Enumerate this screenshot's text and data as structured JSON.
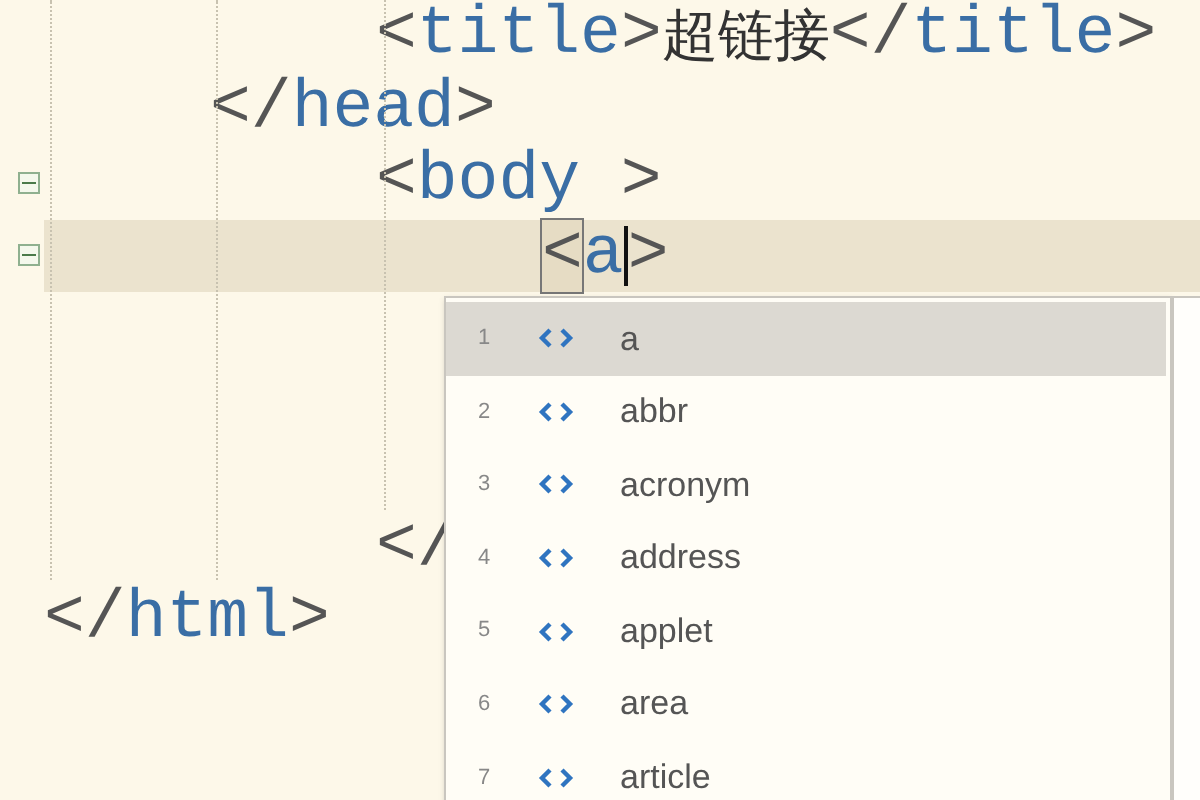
{
  "editor": {
    "children": [
      {
        "children": [
          {
            "children": [
              {
                "current": false,
                "tokens": [
                  {
                    "kind": "punct",
                    "text": "<"
                  },
                  {
                    "kind": "tag",
                    "text": "title"
                  },
                  {
                    "kind": "punct",
                    "text": ">"
                  },
                  {
                    "kind": "text",
                    "text": "超链接"
                  },
                  {
                    "kind": "punct",
                    "text": "</"
                  },
                  {
                    "kind": "tag",
                    "text": "title"
                  },
                  {
                    "kind": "punct",
                    "text": ">"
                  }
                ]
              }
            ]
          },
          {
            "current": false,
            "tokens": [
              {
                "kind": "punct",
                "text": "</"
              },
              {
                "kind": "tag",
                "text": "head"
              },
              {
                "kind": "punct",
                "text": ">"
              }
            ]
          },
          {
            "children": [
              {
                "current": false,
                "fold": true,
                "tokens": [
                  {
                    "kind": "punct",
                    "text": "<"
                  },
                  {
                    "kind": "tag",
                    "text": "body"
                  },
                  {
                    "kind": "punct",
                    "text": " >"
                  }
                ]
              },
              {
                "children": [
                  {
                    "current": true,
                    "fold": true,
                    "tokens": [
                      {
                        "kind": "match",
                        "text": "<"
                      },
                      {
                        "kind": "tag",
                        "text": "a",
                        "caret": true
                      },
                      {
                        "kind": "punct",
                        "text": ">"
                      }
                    ]
                  }
                ]
              },
              {
                "current": false
              },
              {
                "current": false
              },
              {
                "current": false
              },
              {
                "current": false,
                "tokens": [
                  {
                    "kind": "punct",
                    "text": "</"
                  }
                ]
              }
            ]
          }
        ]
      },
      {
        "current": false,
        "tokens": [
          {
            "kind": "punct",
            "text": "</"
          },
          {
            "kind": "tag",
            "text": "html"
          },
          {
            "kind": "punct",
            "text": ">"
          }
        ]
      }
    ]
  },
  "completion": {
    "items": [
      {
        "number": "1",
        "label": "a",
        "selected": true
      },
      {
        "number": "2",
        "label": "abbr",
        "selected": false
      },
      {
        "number": "3",
        "label": "acronym",
        "selected": false
      },
      {
        "number": "4",
        "label": "address",
        "selected": false
      },
      {
        "number": "5",
        "label": "applet",
        "selected": false
      },
      {
        "number": "6",
        "label": "area",
        "selected": false
      },
      {
        "number": "7",
        "label": "article",
        "selected": false
      }
    ]
  }
}
